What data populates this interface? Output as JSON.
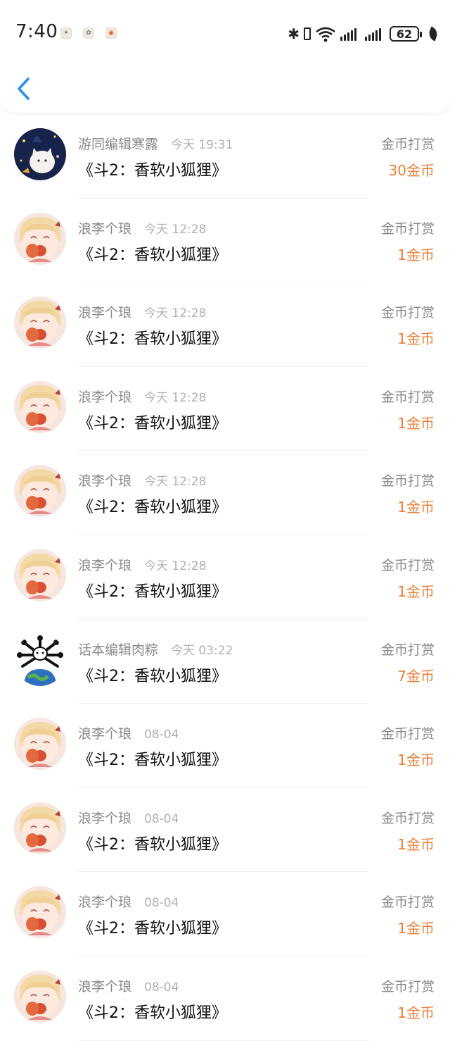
{
  "status_bar": {
    "time": "7:40",
    "battery": "62"
  },
  "header": {
    "back_icon": "chevron-left-icon",
    "accent": "#2d8ef0"
  },
  "colors": {
    "amount": "#ec7e33",
    "secondary_text": "#888888"
  },
  "items": [
    {
      "avatar": "night-cat-avatar",
      "name": "游同编辑寒露",
      "time": "今天 19:31",
      "title": "《斗2：香软小狐狸》",
      "type": "金币打赏",
      "amount": "30金币"
    },
    {
      "avatar": "anime-girl-avatar",
      "name": "浪李个琅",
      "time": "今天 12:28",
      "title": "《斗2：香软小狐狸》",
      "type": "金币打赏",
      "amount": "1金币"
    },
    {
      "avatar": "anime-girl-avatar",
      "name": "浪李个琅",
      "time": "今天 12:28",
      "title": "《斗2：香软小狐狸》",
      "type": "金币打赏",
      "amount": "1金币"
    },
    {
      "avatar": "anime-girl-avatar",
      "name": "浪李个琅",
      "time": "今天 12:28",
      "title": "《斗2：香软小狐狸》",
      "type": "金币打赏",
      "amount": "1金币"
    },
    {
      "avatar": "anime-girl-avatar",
      "name": "浪李个琅",
      "time": "今天 12:28",
      "title": "《斗2：香软小狐狸》",
      "type": "金币打赏",
      "amount": "1金币"
    },
    {
      "avatar": "anime-girl-avatar",
      "name": "浪李个琅",
      "time": "今天 12:28",
      "title": "《斗2：香软小狐狸》",
      "type": "金币打赏",
      "amount": "1金币"
    },
    {
      "avatar": "globe-emblem-avatar",
      "name": "话本编辑肉粽",
      "time": "今天 03:22",
      "title": "《斗2：香软小狐狸》",
      "type": "金币打赏",
      "amount": "7金币"
    },
    {
      "avatar": "anime-girl-avatar",
      "name": "浪李个琅",
      "time": "08-04",
      "title": "《斗2：香软小狐狸》",
      "type": "金币打赏",
      "amount": "1金币"
    },
    {
      "avatar": "anime-girl-avatar",
      "name": "浪李个琅",
      "time": "08-04",
      "title": "《斗2：香软小狐狸》",
      "type": "金币打赏",
      "amount": "1金币"
    },
    {
      "avatar": "anime-girl-avatar",
      "name": "浪李个琅",
      "time": "08-04",
      "title": "《斗2：香软小狐狸》",
      "type": "金币打赏",
      "amount": "1金币"
    },
    {
      "avatar": "anime-girl-avatar",
      "name": "浪李个琅",
      "time": "08-04",
      "title": "《斗2：香软小狐狸》",
      "type": "金币打赏",
      "amount": "1金币"
    }
  ]
}
